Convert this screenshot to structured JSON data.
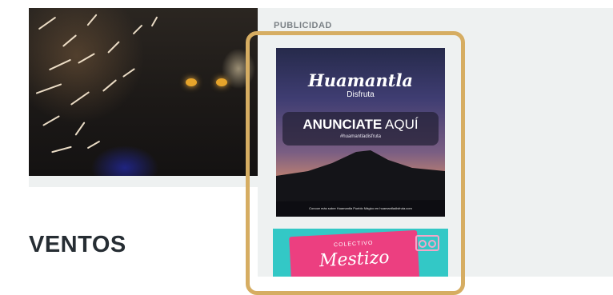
{
  "main": {
    "section_heading": "VENTOS"
  },
  "sidebar": {
    "title": "PUBLICIDAD",
    "highlight_color": "#d6ad62",
    "ads": [
      {
        "brand": "Huamantla",
        "brand_sub": "Disfruta",
        "cta_bold": "ANUNCIATE",
        "cta_light": "AQUÍ",
        "hashtag": "#huamantladisfruta",
        "footer": "Conoce más sobre Huamantla Pueblo Mágico en huamantladisfruta.com"
      },
      {
        "brand_sub": "COLECTIVO",
        "brand": "Mestizo",
        "icon": "radio-icon"
      }
    ]
  }
}
